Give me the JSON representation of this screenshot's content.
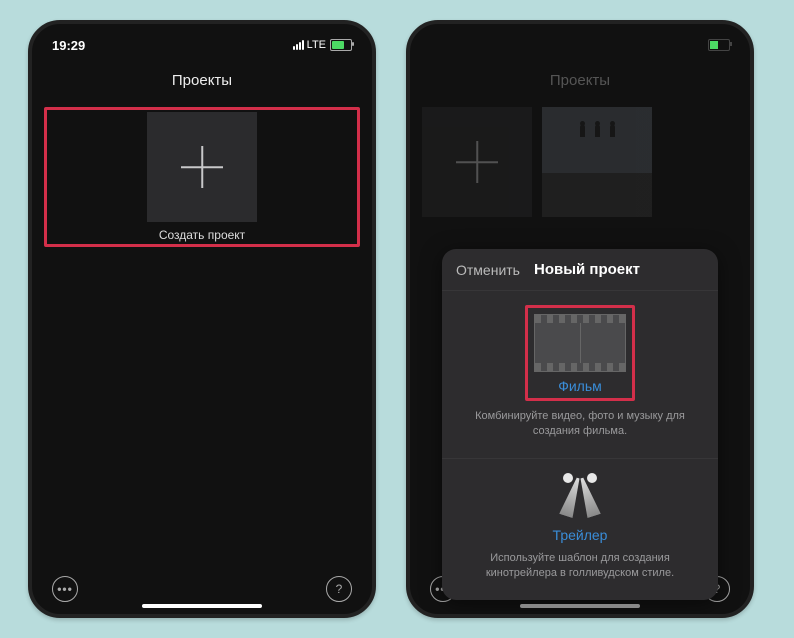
{
  "phoneA": {
    "status": {
      "time": "19:29",
      "network": "LTE"
    },
    "header": {
      "title": "Проекты"
    },
    "create": {
      "label": "Создать проект"
    }
  },
  "phoneB": {
    "header": {
      "title": "Проекты"
    },
    "modal": {
      "cancel": "Отменить",
      "title": "Новый проект",
      "film": {
        "label": "Фильм",
        "desc": "Комбинируйте видео, фото и музыку для создания фильма."
      },
      "trailer": {
        "label": "Трейлер",
        "desc": "Используйте шаблон для создания кинотрейлера в голливудском стиле."
      }
    }
  },
  "icons": {
    "more": "•••",
    "help": "?"
  }
}
